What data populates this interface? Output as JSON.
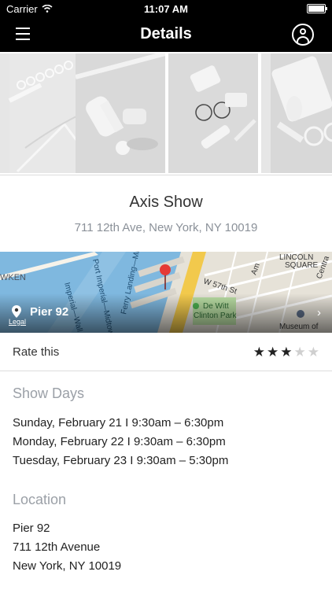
{
  "status": {
    "carrier": "Carrier",
    "time": "11:07 AM"
  },
  "nav": {
    "title": "Details"
  },
  "venue": {
    "name": "Axis Show",
    "address": "711 12th Ave, New York, NY 10019"
  },
  "map": {
    "label": "Pier 92",
    "legal": "Legal"
  },
  "rating": {
    "label": "Rate this",
    "value": 3,
    "max": 5
  },
  "show_days": {
    "title": "Show Days",
    "items": [
      "Sunday, February 21 I 9:30am – 6:30pm",
      "Monday, February 22 I 9:30am – 6:30pm",
      "Tuesday, February 23 I 9:30am – 5:30pm"
    ]
  },
  "location": {
    "title": "Location",
    "lines": [
      "Pier 92",
      "711 12th Avenue",
      "New York, NY 10019"
    ]
  },
  "colors": {
    "nav_bg": "#000000",
    "section_title": "#9ba0a7",
    "address": "#8b9199",
    "map_pin": "#e53935"
  }
}
